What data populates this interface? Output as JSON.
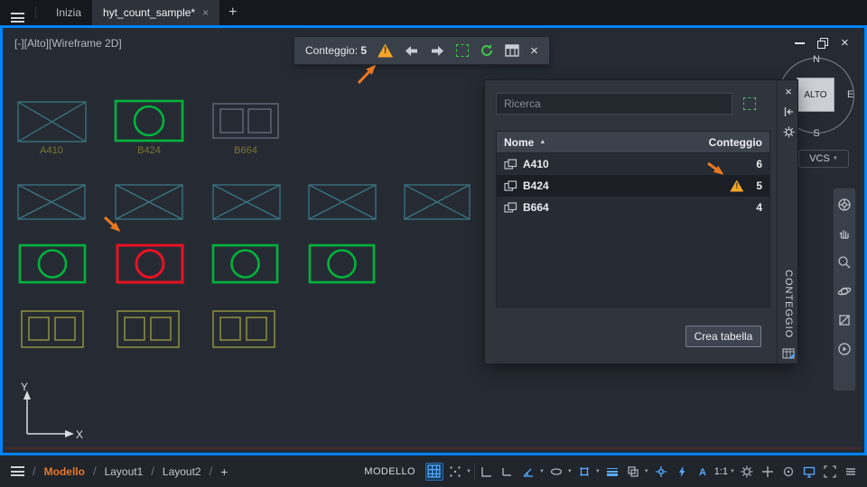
{
  "colors": {
    "viewport_border": "#0084ff",
    "highlight_green": "#00b33c",
    "highlight_red": "#e81123",
    "wireframe_teal": "#3a7583",
    "wireframe_olive": "#8f8f3f",
    "warning_orange": "#f4a62a",
    "annotation_arrow": "#e87722"
  },
  "tab_bar": {
    "tabs": [
      {
        "label": "Inizia",
        "active": false
      },
      {
        "label": "hyt_count_sample*",
        "active": true
      }
    ],
    "new_tab": "+"
  },
  "viewport": {
    "label": "[-][Alto][Wireframe 2D]"
  },
  "count_toolbar": {
    "label": "Conteggio:",
    "count": "5"
  },
  "palette": {
    "search_placeholder": "Ricerca",
    "vertical_title": "CONTEGGIO",
    "create_table_label": "Crea tabella",
    "table": {
      "columns": {
        "name": "Nome",
        "count": "Conteggio"
      },
      "rows": [
        {
          "name": "A410",
          "count": "6",
          "warning": false,
          "selected": false
        },
        {
          "name": "B424",
          "count": "5",
          "warning": true,
          "selected": true
        },
        {
          "name": "B664",
          "count": "4",
          "warning": false,
          "selected": false
        }
      ]
    }
  },
  "viewcube": {
    "north": "N",
    "east": "E",
    "south": "S",
    "face_label": "ALTO",
    "vcs_label": "VCS"
  },
  "drawing": {
    "labels": {
      "a410": "A410",
      "b424": "B424",
      "b664": "B664"
    },
    "ucs": {
      "x_label": "X",
      "y_label": "Y"
    }
  },
  "bottom_bar": {
    "layout_tabs": [
      "Modello",
      "Layout1",
      "Layout2"
    ],
    "new_layout": "+",
    "mode_label": "MODELLO",
    "scale": "1:1"
  },
  "icons": {
    "warning": "triangle-exclamation",
    "selection": "green-dashed-square",
    "refresh": "circular-arrow",
    "prev": "arrow-left",
    "next": "arrow-right",
    "table": "grid-table",
    "close": "x-mark"
  }
}
